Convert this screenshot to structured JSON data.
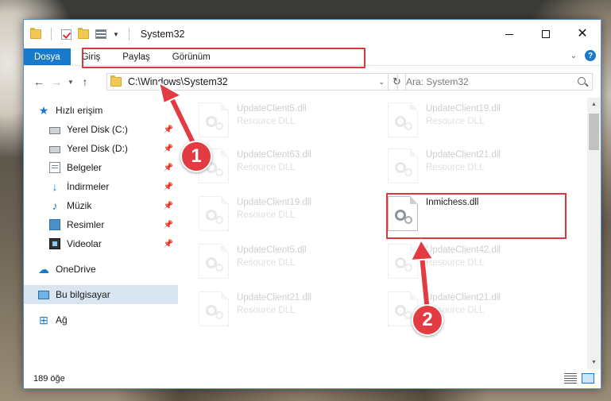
{
  "window": {
    "title": "System32"
  },
  "ribbon": {
    "tabs": [
      "Dosya",
      "Giriş",
      "Paylaş",
      "Görünüm"
    ]
  },
  "address": {
    "path": "C:\\Windows\\System32",
    "search_placeholder": "Ara: System32"
  },
  "nav": {
    "quick_access": "Hızlı erişim",
    "items": [
      "Yerel Disk (C:)",
      "Yerel Disk (D:)",
      "Belgeler",
      "İndirmeler",
      "Müzik",
      "Resimler",
      "Videolar"
    ],
    "onedrive": "OneDrive",
    "this_pc": "Bu bilgisayar",
    "network": "Ağ"
  },
  "files": [
    {
      "name": "UpdateClient5.dll",
      "type": "Resource DLL"
    },
    {
      "name": "UpdateClient19.dll",
      "type": "Resource DLL"
    },
    {
      "name": "UpdateClient63.dll",
      "type": "Resource DLL"
    },
    {
      "name": "UpdateClient21.dll",
      "type": "Resource DLL"
    },
    {
      "name": "UpdateClient19.dll",
      "type": "Resource DLL"
    },
    {
      "name": "Inmichess.dll",
      "type": ""
    },
    {
      "name": "UpdateClient5.dll",
      "type": "Resource DLL"
    },
    {
      "name": "UpdateClient42.dll",
      "type": "Resource DLL"
    },
    {
      "name": "UpdateClient21.dll",
      "type": "Resource DLL"
    },
    {
      "name": "UpdateClient21.dll",
      "type": "Resource DLL"
    }
  ],
  "status": {
    "item_count": "189 öğe"
  },
  "callouts": [
    "1",
    "2"
  ],
  "colors": {
    "accent": "#1979ca",
    "highlight": "#d9363e",
    "badge": "#e23b41"
  }
}
